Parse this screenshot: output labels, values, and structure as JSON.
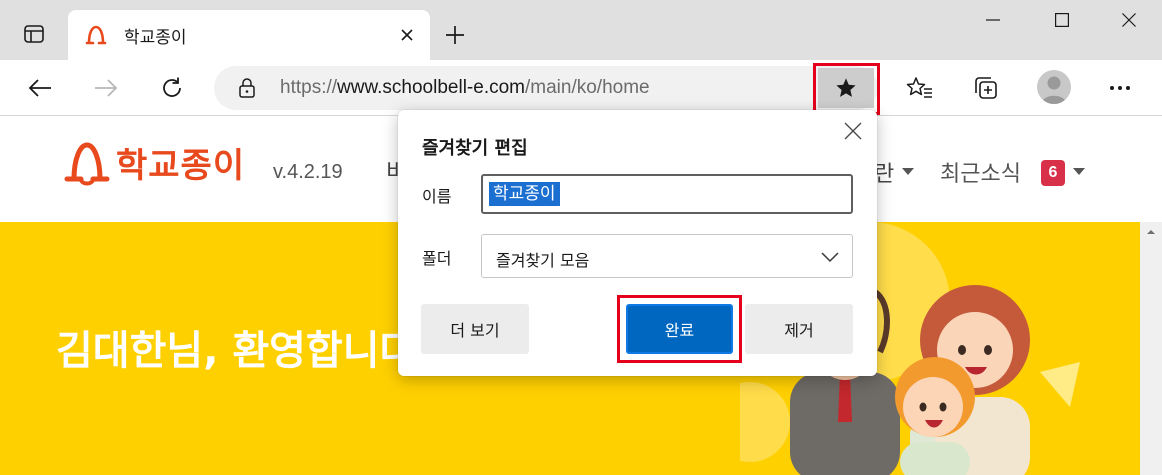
{
  "colors": {
    "accent": "#0067c0",
    "highlight": "#e4001b",
    "brand": "#e8491d",
    "banner": "#ffd000",
    "badge": "#d9304a"
  },
  "tab": {
    "title": "학교종이",
    "favicon": "schoolbell-logo-icon"
  },
  "address_bar": {
    "url_prefix": "https://",
    "url_host": "www.schoolbell-e.com",
    "url_path": "/main/ko/home"
  },
  "site": {
    "logo_text": "학교종이",
    "version": "v.4.2.19",
    "menu_partial_left": "비",
    "menu_partial_right": "란",
    "news_label": "최근소식",
    "news_count": "6",
    "welcome": "김대한님, 환영합니다"
  },
  "dialog": {
    "title": "즐겨찾기 편집",
    "name_label": "이름",
    "name_value": "학교종이",
    "folder_label": "폴더",
    "folder_value": "즐겨찾기 모음",
    "more_button": "더 보기",
    "done_button": "완료",
    "remove_button": "제거"
  }
}
